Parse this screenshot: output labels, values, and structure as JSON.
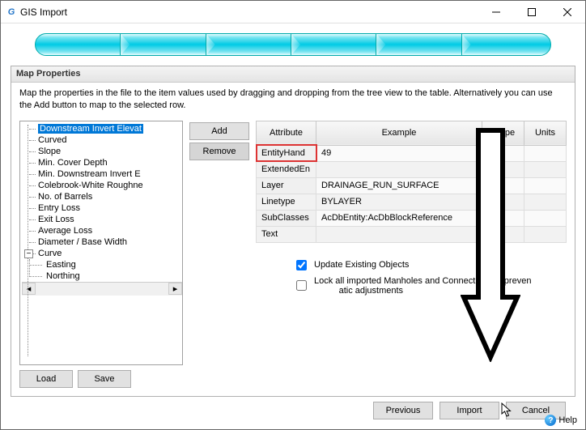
{
  "window": {
    "title": "GIS Import"
  },
  "group": {
    "title": "Map Properties"
  },
  "description": "Map the properties in the file to the item values used by dragging and dropping from the tree view to the table. Alternatively you can use the Add button to map to the selected row.",
  "tree": {
    "items": [
      {
        "label": "Downstream Invert Elevat",
        "selected": true
      },
      {
        "label": "Curved"
      },
      {
        "label": "Slope"
      },
      {
        "label": "Min. Cover Depth"
      },
      {
        "label": "Min. Downstream Invert E"
      },
      {
        "label": "Colebrook-White Roughne"
      },
      {
        "label": "No. of Barrels"
      },
      {
        "label": "Entry Loss"
      },
      {
        "label": "Exit Loss"
      },
      {
        "label": "Average Loss"
      },
      {
        "label": "Diameter / Base Width"
      },
      {
        "label": "Curve",
        "expandable": true,
        "expanded": true,
        "children": [
          {
            "label": "Easting"
          },
          {
            "label": "Northing"
          }
        ]
      }
    ]
  },
  "buttons": {
    "load": "Load",
    "save": "Save",
    "add": "Add",
    "remove": "Remove",
    "previous": "Previous",
    "import": "Import",
    "cancel": "Cancel",
    "help": "Help"
  },
  "table": {
    "headers": {
      "attr": "Attribute",
      "example": "Example",
      "prop": "Prope",
      "units": "Units"
    },
    "rows": [
      {
        "attr": "EntityHand",
        "example": "49",
        "highlight": true
      },
      {
        "attr": "ExtendedEn",
        "example": ""
      },
      {
        "attr": "Layer",
        "example": "DRAINAGE_RUN_SURFACE"
      },
      {
        "attr": "Linetype",
        "example": "BYLAYER"
      },
      {
        "attr": "SubClasses",
        "example": "AcDbEntity:AcDbBlockReference"
      },
      {
        "attr": "Text",
        "example": ""
      }
    ]
  },
  "checks": {
    "update": {
      "label": "Update Existing Objects",
      "checked": true
    },
    "lock": {
      "label": "Lock all imported Manholes and Connections to prevent automatic adjustments",
      "label_vis_pre": "Lock all imported Manholes and Connections to preven",
      "label_vis_post": "atic adjustments",
      "checked": false
    }
  }
}
